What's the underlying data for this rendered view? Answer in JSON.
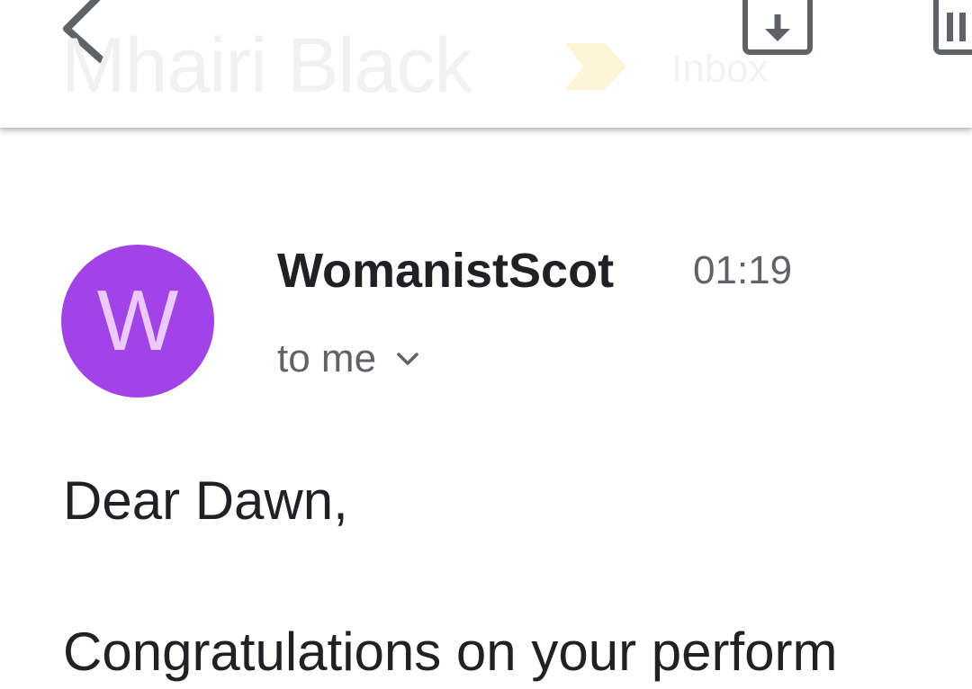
{
  "toolbar": {
    "subject": "Mhairi Black",
    "label": "Inbox",
    "icons": {
      "back": "back-arrow-icon",
      "important": "important-marker-icon",
      "archive": "archive-download-icon",
      "more": "toolbar-more-icon"
    }
  },
  "message": {
    "sender_initial": "W",
    "sender_name": "WomanistScot",
    "time": "01:19",
    "recipients": "to me",
    "expand_icon": "chevron-down-icon",
    "body_lines": [
      "Dear Dawn,",
      "Congratulations on your perform"
    ]
  },
  "colors": {
    "avatar_bg": "#a243e8",
    "avatar_text": "#eccaff",
    "icon_gray": "#5f6368",
    "important_yellow": "#fdf6d6"
  }
}
